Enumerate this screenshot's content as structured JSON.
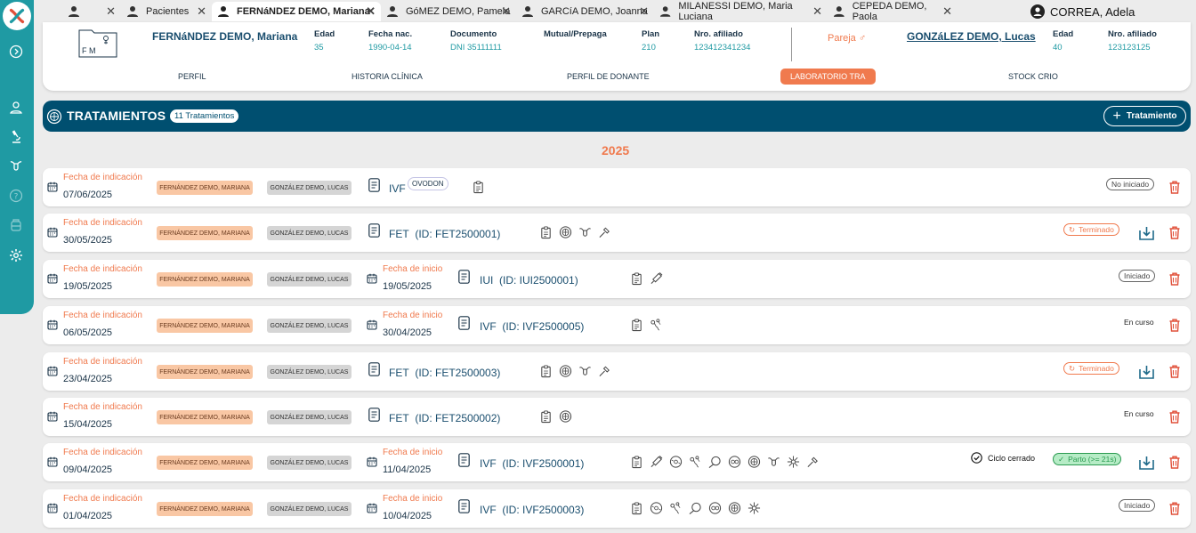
{
  "app": {
    "user_name": "CORREA, Adela"
  },
  "tabs": [
    {
      "label": ""
    },
    {
      "label": "Pacientes"
    },
    {
      "label": "FERNáNDEZ DEMO, Mariana"
    },
    {
      "label": "GóMEZ DEMO, Pamela"
    },
    {
      "label": "GARCíA DEMO, Joanna"
    },
    {
      "label": "MILANESSI DEMO, Maria Luciana"
    },
    {
      "label": "CEPEDA DEMO, Paola"
    }
  ],
  "patient": {
    "folder_letters": "F M",
    "name": "FERNáNDEZ DEMO, Mariana",
    "fields": [
      {
        "label": "Edad",
        "value": "35"
      },
      {
        "label": "Fecha nac.",
        "value": "1990-04-14"
      },
      {
        "label": "Documento",
        "value": "DNI 35111111"
      },
      {
        "label": "Mutual/Prepaga",
        "value": ""
      },
      {
        "label": "Plan",
        "value": "210"
      },
      {
        "label": "Nro. afiliado",
        "value": "123412341234"
      }
    ],
    "partner_label": "Pareja",
    "partner_name": "GONZáLEZ DEMO, Lucas",
    "partner_fields": [
      {
        "label": "Edad",
        "value": "40"
      },
      {
        "label": "Nro. afiliado",
        "value": "123123125"
      }
    ]
  },
  "nav": [
    "PERFIL",
    "HISTORIA CLÍNICA",
    "PERFIL DE DONANTE",
    "LABORATORIO TRA",
    "STOCK CRIO"
  ],
  "section": {
    "title": "TRATAMIENTOS",
    "count": "11 Tratamientos",
    "add_label": "Tratamiento",
    "year": "2025"
  },
  "labels": {
    "indicacion": "Fecha de indicación",
    "inicio": "Fecha de inicio",
    "ciclo_cerrado": "Ciclo cerrado"
  },
  "rows": [
    {
      "fecha_ind": "07/06/2025",
      "patient": "FERNÁNDEZ DEMO, MARIANA",
      "partner": "GONZÁLEZ DEMO, LUCAS",
      "fecha_ini": "",
      "type": "IVF",
      "id": "",
      "tag": "OVODON",
      "icons": [
        "clipboard-icon"
      ],
      "status": "No iniciado",
      "status_kind": "gray",
      "download": false,
      "closed": false
    },
    {
      "fecha_ind": "30/05/2025",
      "patient": "FERNÁNDEZ DEMO, MARIANA",
      "partner": "GONZÁLEZ DEMO, LUCAS",
      "fecha_ini": "",
      "type": "FET",
      "id": "(ID: FET2500001)",
      "tag": "",
      "icons": [
        "clipboard-icon",
        "embryo-icon",
        "uterus-icon",
        "pipette-icon"
      ],
      "status": "Terminado",
      "status_kind": "term",
      "download": true,
      "closed": false
    },
    {
      "fecha_ind": "19/05/2025",
      "patient": "FERNÁNDEZ DEMO, MARIANA",
      "partner": "GONZÁLEZ DEMO, LUCAS",
      "fecha_ini": "19/05/2025",
      "type": "IUI",
      "id": "(ID: IUI2500001)",
      "tag": "",
      "icons": [
        "clipboard-icon",
        "syringe-icon"
      ],
      "status": "Iniciado",
      "status_kind": "gray",
      "download": false,
      "closed": false
    },
    {
      "fecha_ind": "06/05/2025",
      "patient": "FERNÁNDEZ DEMO, MARIANA",
      "partner": "GONZÁLEZ DEMO, LUCAS",
      "fecha_ini": "30/04/2025",
      "type": "IVF",
      "id": "(ID: IVF2500005)",
      "tag": "",
      "icons": [
        "clipboard-icon",
        "sperm-icon"
      ],
      "status": "En curso",
      "status_kind": "plain",
      "download": false,
      "closed": false
    },
    {
      "fecha_ind": "23/04/2025",
      "patient": "FERNÁNDEZ DEMO, MARIANA",
      "partner": "GONZÁLEZ DEMO, LUCAS",
      "fecha_ini": "",
      "type": "FET",
      "id": "(ID: FET2500003)",
      "tag": "",
      "icons": [
        "clipboard-icon",
        "embryo-icon",
        "uterus-icon",
        "pipette-icon"
      ],
      "status": "Terminado",
      "status_kind": "term",
      "download": true,
      "closed": false
    },
    {
      "fecha_ind": "15/04/2025",
      "patient": "FERNÁNDEZ DEMO, MARIANA",
      "partner": "GONZÁLEZ DEMO, LUCAS",
      "fecha_ini": "",
      "type": "FET",
      "id": "(ID: FET2500002)",
      "tag": "",
      "icons": [
        "clipboard-icon",
        "embryo-icon"
      ],
      "status": "En curso",
      "status_kind": "plain",
      "download": false,
      "closed": false
    },
    {
      "fecha_ind": "09/04/2025",
      "patient": "FERNÁNDEZ DEMO, MARIANA",
      "partner": "GONZÁLEZ DEMO, LUCAS",
      "fecha_ini": "11/04/2025",
      "type": "IVF",
      "id": "(ID: IVF2500001)",
      "tag": "",
      "icons": [
        "clipboard-icon",
        "syringe-icon",
        "oocyte-icon",
        "sperm-icon",
        "icsi-icon",
        "zygote-icon",
        "embryo-icon",
        "uterus-icon",
        "cryo-icon",
        "pipette-icon"
      ],
      "status": "Parto (>= 21s)",
      "status_kind": "parto",
      "download": true,
      "closed": true
    },
    {
      "fecha_ind": "01/04/2025",
      "patient": "FERNÁNDEZ DEMO, MARIANA",
      "partner": "GONZÁLEZ DEMO, LUCAS",
      "fecha_ini": "10/04/2025",
      "type": "IVF",
      "id": "(ID: IVF2500003)",
      "tag": "",
      "icons": [
        "clipboard-icon",
        "oocyte-icon",
        "sperm-icon",
        "icsi-icon",
        "zygote-icon",
        "embryo-icon",
        "cryo-icon"
      ],
      "status": "Iniciado",
      "status_kind": "gray",
      "download": false,
      "closed": false
    }
  ]
}
